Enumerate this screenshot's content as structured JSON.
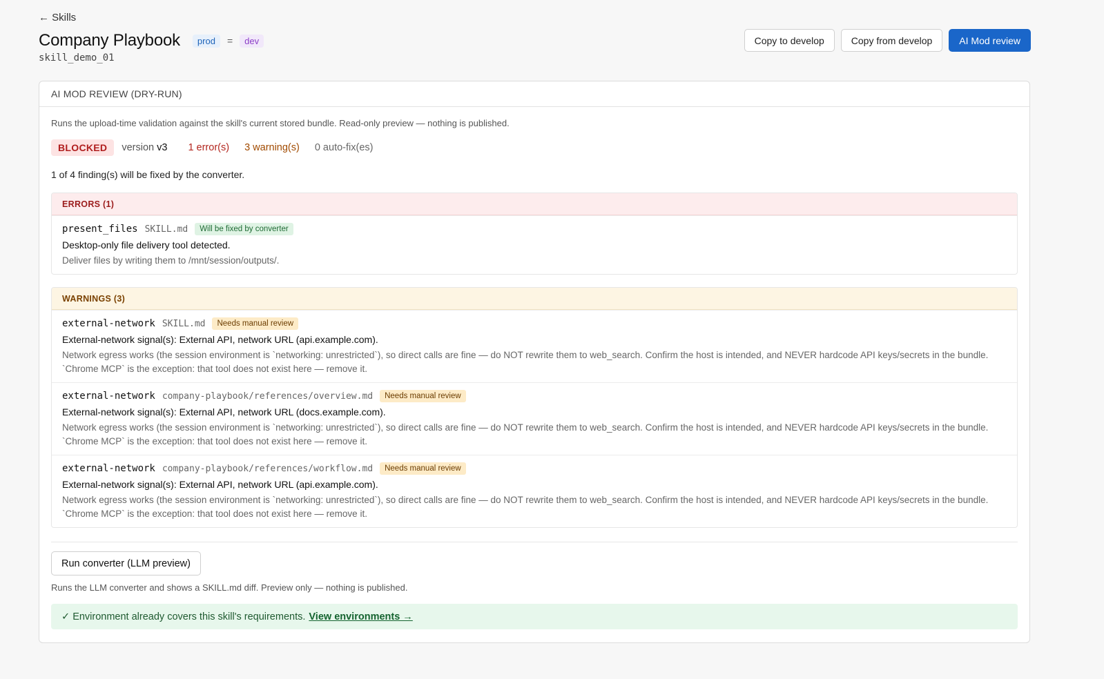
{
  "nav": {
    "back_label": "← Skills"
  },
  "header": {
    "title": "Company Playbook",
    "env_prod": "prod",
    "env_equals": "=",
    "env_dev": "dev",
    "slug": "skill_demo_01"
  },
  "actions": {
    "copy_to": "Copy to develop",
    "copy_from": "Copy from develop",
    "ai_review": "AI Mod review"
  },
  "review": {
    "heading": "AI MOD REVIEW (DRY-RUN)",
    "description": "Runs the upload-time validation against the skill's current stored bundle. Read-only preview — nothing is published.",
    "status": "BLOCKED",
    "version_label": "version",
    "version": "v3",
    "errors_count": "1 error(s)",
    "warnings_count": "3 warning(s)",
    "autofix_count": "0 auto-fix(es)",
    "fix_note": "1 of 4 finding(s) will be fixed by the converter.",
    "errors": {
      "heading": "ERRORS (1)",
      "items": [
        {
          "code": "present_files",
          "file": "SKILL.md",
          "tag": "Will be fixed by converter",
          "message": "Desktop-only file delivery tool detected.",
          "hint": "Deliver files by writing them to /mnt/session/outputs/."
        }
      ]
    },
    "warnings": {
      "heading": "WARNINGS (3)",
      "items": [
        {
          "code": "external-network",
          "file": "SKILL.md",
          "tag": "Needs manual review",
          "message": "External-network signal(s): External API, network URL (api.example.com).",
          "hint": "Network egress works (the session environment is `networking: unrestricted`), so direct calls are fine — do NOT rewrite them to web_search. Confirm the host is intended, and NEVER hardcode API keys/secrets in the bundle. `Chrome MCP` is the exception: that tool does not exist here — remove it."
        },
        {
          "code": "external-network",
          "file": "company-playbook/references/overview.md",
          "tag": "Needs manual review",
          "message": "External-network signal(s): External API, network URL (docs.example.com).",
          "hint": "Network egress works (the session environment is `networking: unrestricted`), so direct calls are fine — do NOT rewrite them to web_search. Confirm the host is intended, and NEVER hardcode API keys/secrets in the bundle. `Chrome MCP` is the exception: that tool does not exist here — remove it."
        },
        {
          "code": "external-network",
          "file": "company-playbook/references/workflow.md",
          "tag": "Needs manual review",
          "message": "External-network signal(s): External API, network URL (api.example.com).",
          "hint": "Network egress works (the session environment is `networking: unrestricted`), so direct calls are fine — do NOT rewrite them to web_search. Confirm the host is intended, and NEVER hardcode API keys/secrets in the bundle. `Chrome MCP` is the exception: that tool does not exist here — remove it."
        }
      ]
    },
    "converter_button": "Run converter (LLM preview)",
    "converter_desc": "Runs the LLM converter and shows a SKILL.md diff. Preview only — nothing is published.",
    "env_check_icon": "✓",
    "env_message": "Environment already covers this skill's requirements.",
    "env_link": "View environments →"
  },
  "colors": {
    "primary": "#1a66c9",
    "blocked": "#b01d1d",
    "warning": "#a14a00",
    "success_bg": "#e7f7ec"
  }
}
